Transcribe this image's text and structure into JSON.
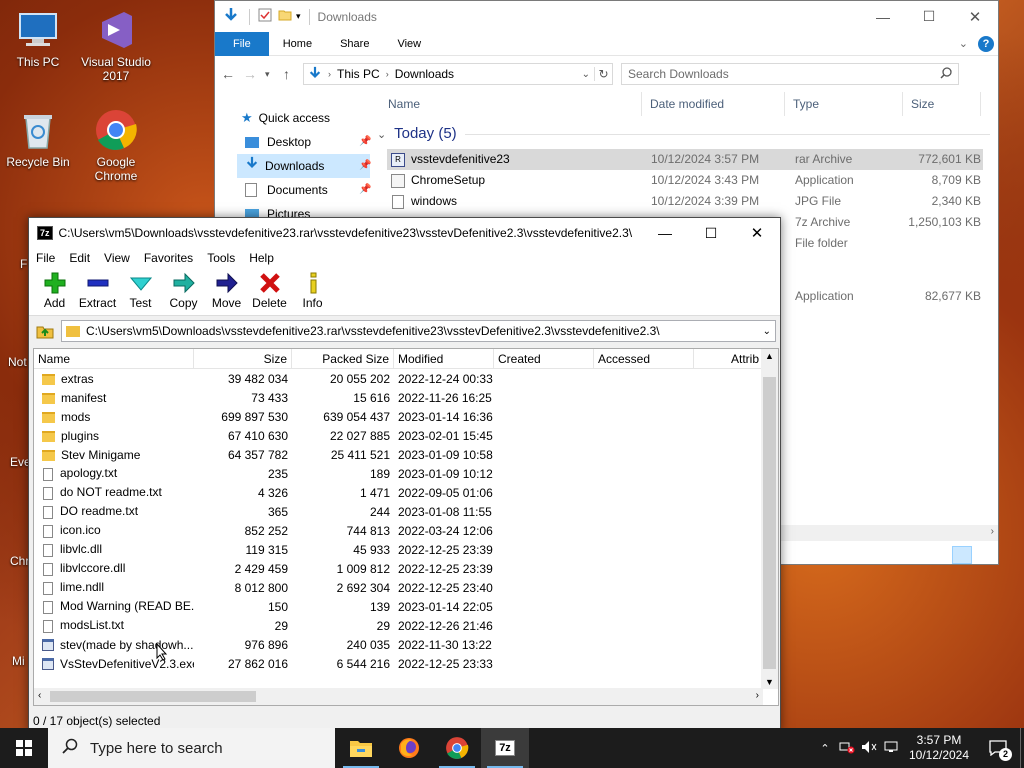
{
  "desktop": {
    "icons": [
      {
        "label": "This PC"
      },
      {
        "label": "Visual Studio 2017"
      },
      {
        "label": "Recycle Bin"
      },
      {
        "label": "Google Chrome"
      }
    ],
    "partial_labels": [
      "F",
      "Not",
      "Eve",
      "Chr",
      "Mi"
    ]
  },
  "explorer": {
    "title": "Downloads",
    "ribbon_tabs": [
      "File",
      "Home",
      "Share",
      "View"
    ],
    "breadcrumb": [
      "This PC",
      "Downloads"
    ],
    "search_placeholder": "Search Downloads",
    "nav": [
      {
        "label": "Quick access"
      },
      {
        "label": "Desktop"
      },
      {
        "label": "Downloads"
      },
      {
        "label": "Documents"
      },
      {
        "label": "Pictures"
      }
    ],
    "columns": [
      "Name",
      "Date modified",
      "Type",
      "Size"
    ],
    "group": "Today (5)",
    "rows": [
      {
        "name": "vsstevdefenitive23",
        "date": "10/12/2024 3:57 PM",
        "type": "rar Archive",
        "size": "772,601 KB"
      },
      {
        "name": "ChromeSetup",
        "date": "10/12/2024 3:43 PM",
        "type": "Application",
        "size": "8,709 KB"
      },
      {
        "name": "windows",
        "date": "10/12/2024 3:39 PM",
        "type": "JPG File",
        "size": "2,340 KB"
      },
      {
        "name": "",
        "date": "",
        "type": "7z Archive",
        "size": "1,250,103 KB"
      },
      {
        "name": "",
        "date": "",
        "type": "File folder",
        "size": ""
      },
      {
        "name": "",
        "date": "",
        "type": "Application",
        "size": "82,677 KB"
      }
    ]
  },
  "sevenzip": {
    "title": "C:\\Users\\vm5\\Downloads\\vsstevdefenitive23.rar\\vsstevdefenitive23\\vsstevDefenitive2.3\\vsstevdefenitive2.3\\",
    "menu": [
      "File",
      "Edit",
      "View",
      "Favorites",
      "Tools",
      "Help"
    ],
    "toolbar": {
      "add": "Add",
      "extract": "Extract",
      "test": "Test",
      "copy": "Copy",
      "move": "Move",
      "delete": "Delete",
      "info": "Info"
    },
    "path": "C:\\Users\\vm5\\Downloads\\vsstevdefenitive23.rar\\vsstevdefenitive23\\vsstevDefenitive2.3\\vsstevdefenitive2.3\\",
    "columns": [
      "Name",
      "Size",
      "Packed Size",
      "Modified",
      "Created",
      "Accessed",
      "Attrib"
    ],
    "rows": [
      {
        "name": "extras",
        "size": "39 482 034",
        "packed": "20 055 202",
        "modified": "2022-12-24 00:33",
        "kind": "folder"
      },
      {
        "name": "manifest",
        "size": "73 433",
        "packed": "15 616",
        "modified": "2022-11-26 16:25",
        "kind": "folder"
      },
      {
        "name": "mods",
        "size": "699 897 530",
        "packed": "639 054 437",
        "modified": "2023-01-14 16:36",
        "kind": "folder"
      },
      {
        "name": "plugins",
        "size": "67 410 630",
        "packed": "22 027 885",
        "modified": "2023-02-01 15:45",
        "kind": "folder"
      },
      {
        "name": "Stev Minigame",
        "size": "64 357 782",
        "packed": "25 411 521",
        "modified": "2023-01-09 10:58",
        "kind": "folder"
      },
      {
        "name": "apology.txt",
        "size": "235",
        "packed": "189",
        "modified": "2023-01-09 10:12",
        "kind": "file"
      },
      {
        "name": "do NOT readme.txt",
        "size": "4 326",
        "packed": "1 471",
        "modified": "2022-09-05 01:06",
        "kind": "file"
      },
      {
        "name": "DO readme.txt",
        "size": "365",
        "packed": "244",
        "modified": "2023-01-08 11:55",
        "kind": "file"
      },
      {
        "name": "icon.ico",
        "size": "852 252",
        "packed": "744 813",
        "modified": "2022-03-24 12:06",
        "kind": "file"
      },
      {
        "name": "libvlc.dll",
        "size": "119 315",
        "packed": "45 933",
        "modified": "2022-12-25 23:39",
        "kind": "file"
      },
      {
        "name": "libvlccore.dll",
        "size": "2 429 459",
        "packed": "1 009 812",
        "modified": "2022-12-25 23:39",
        "kind": "file"
      },
      {
        "name": "lime.ndll",
        "size": "8 012 800",
        "packed": "2 692 304",
        "modified": "2022-12-25 23:40",
        "kind": "file"
      },
      {
        "name": "Mod Warning (READ BE...",
        "size": "150",
        "packed": "139",
        "modified": "2023-01-14 22:05",
        "kind": "file"
      },
      {
        "name": "modsList.txt",
        "size": "29",
        "packed": "29",
        "modified": "2022-12-26 21:46",
        "kind": "file"
      },
      {
        "name": "stev(made by shadowh...",
        "size": "976 896",
        "packed": "240 035",
        "modified": "2022-11-30 13:22",
        "kind": "exe"
      },
      {
        "name": "VsStevDefenitiveV2.3.exe",
        "size": "27 862 016",
        "packed": "6 544 216",
        "modified": "2022-12-25 23:33",
        "kind": "exe"
      }
    ],
    "status": "0 / 17 object(s) selected"
  },
  "taskbar": {
    "search_placeholder": "Type here to search",
    "time": "3:57 PM",
    "date": "10/12/2024",
    "notifications": "2"
  },
  "colors": {
    "accent": "#1979ca",
    "taskbar": "#1c1c1c",
    "selection": "#cce8ff"
  }
}
